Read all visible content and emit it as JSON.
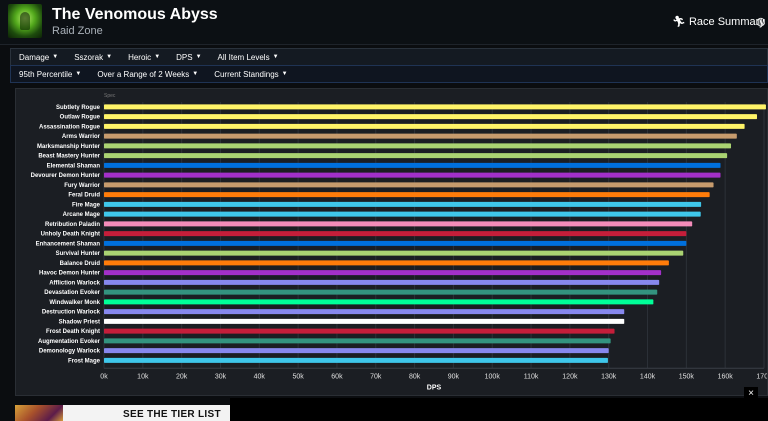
{
  "header": {
    "title": "The Venomous Abyss",
    "subtitle": "Raid Zone",
    "race_summary": "Race Summary",
    "zone_icon": "venom-zone-icon",
    "race_icon": "runner-icon",
    "globe_icon": "globe-icon"
  },
  "filters_primary": [
    "Damage",
    "Sszorak",
    "Heroic",
    "DPS",
    "All Item Levels"
  ],
  "filters_secondary": [
    "95th Percentile",
    "Over a Range of 2 Weeks",
    "Current Standings"
  ],
  "chart_data": {
    "type": "bar",
    "orientation": "horizontal",
    "xlabel": "DPS",
    "xlim": [
      0,
      170000
    ],
    "xticks": [
      "0k",
      "10k",
      "20k",
      "30k",
      "40k",
      "50k",
      "60k",
      "70k",
      "80k",
      "90k",
      "100k",
      "110k",
      "120k",
      "130k",
      "140k",
      "150k",
      "160k",
      "170k"
    ],
    "grid": true,
    "categories": [
      "Subtlety Rogue",
      "Outlaw Rogue",
      "Assassination Rogue",
      "Arms Warrior",
      "Marksmanship Hunter",
      "Beast Mastery Hunter",
      "Elemental Shaman",
      "Devourer Demon Hunter",
      "Fury Warrior",
      "Feral Druid",
      "Fire Mage",
      "Arcane Mage",
      "Retribution Paladin",
      "Unholy Death Knight",
      "Enhancement Shaman",
      "Survival Hunter",
      "Balance Druid",
      "Havoc Demon Hunter",
      "Affliction Warlock",
      "Devastation Evoker",
      "Windwalker Monk",
      "Destruction Warlock",
      "Shadow Priest",
      "Frost Death Knight",
      "Augmentation Evoker",
      "Demonology Warlock",
      "Frost Mage"
    ],
    "values": [
      170500,
      168200,
      165000,
      163000,
      161500,
      160500,
      158800,
      158800,
      157000,
      156000,
      153800,
      153700,
      151500,
      150000,
      150000,
      149200,
      145500,
      143500,
      143000,
      142500,
      141500,
      134000,
      134000,
      131500,
      130500,
      130000,
      129800
    ],
    "colors": [
      "#FFF468",
      "#FFF468",
      "#FFF468",
      "#C69B6D",
      "#AAD372",
      "#AAD372",
      "#0070DD",
      "#A330C9",
      "#C69B6D",
      "#FF7C0A",
      "#3FC7EB",
      "#3FC7EB",
      "#F48CBA",
      "#C41E3A",
      "#0070DD",
      "#AAD372",
      "#FF7C0A",
      "#A330C9",
      "#8788EE",
      "#33937F",
      "#00FF98",
      "#8788EE",
      "#FFFFFF",
      "#C41E3A",
      "#33937F",
      "#8788EE",
      "#3FC7EB"
    ],
    "series_label": "Spec"
  },
  "banner": {
    "text": "SEE THE TIER LIST",
    "close": "×"
  }
}
